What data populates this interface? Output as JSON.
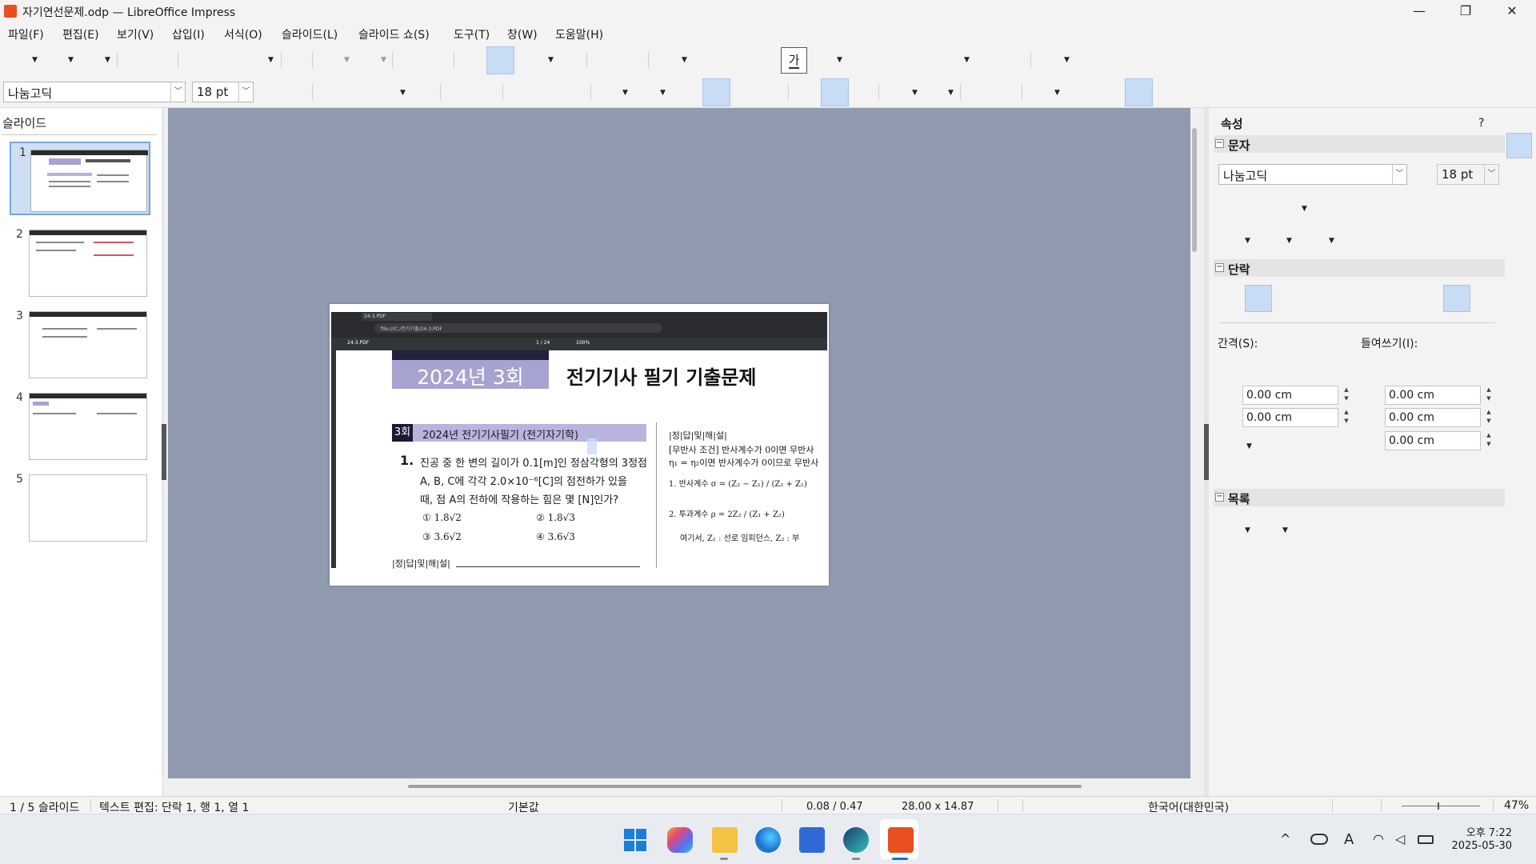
{
  "window": {
    "title": "자기연선문제.odp — LibreOffice Impress",
    "minimize": "—",
    "maximize": "❐",
    "close": "✕"
  },
  "menu": [
    "파일(F)",
    "편집(E)",
    "보기(V)",
    "삽입(I)",
    "서식(O)",
    "슬라이드(L)",
    "슬라이드 쇼(S)",
    "도구(T)",
    "창(W)",
    "도움말(H)"
  ],
  "toolbar": {
    "textbox_icon": "가",
    "font_name": "나눔고딕",
    "font_size": "18 pt"
  },
  "slides_panel": {
    "header": "슬라이드",
    "numbers": [
      "1",
      "2",
      "3",
      "4",
      "5"
    ]
  },
  "slide": {
    "browser_url": "file:///C:/전기기출/24-3.PDF",
    "tab_label": "24-3.PDF",
    "pdf_name": "24-3.PDF",
    "page": "1 / 24",
    "zoom": "100%",
    "year_label": "2024년  3회",
    "exam_title": "전기기사 필기 기출문제",
    "section_badge": "3회",
    "section_title": "2024년 전기기사필기 (전기자기학)",
    "q_num": "1.",
    "q_line1": "진공 중 한 변의 길이가 0.1[m]인 정삼각형의 3정점",
    "q_line2": "A, B, C에 각각 2.0×10⁻⁶[C]의 점전하가 있을",
    "q_line3": "때, 점 A의 전하에 작용하는 힘은 몇 [N]인가?",
    "choices": [
      "① 1.8√2",
      "② 1.8√3",
      "③ 3.6√2",
      "④ 3.6√3"
    ],
    "answer_head_left": "|정|답|및|해|설|",
    "answer_head_right": "|정|답|및|해|설|",
    "ans1": "[무반사 조건] 반사계수가 0이면 무반사",
    "ans2": "η₁ = η₂이면 반사계수가 0이므로 무반사",
    "ans3": "1. 반사계수 σ = (Z₂ − Z₁) / (Z₂ + Z₁)",
    "ans4": "2. 투과계수 ρ = 2Z₂ / (Z₁ + Z₂)",
    "ans5": "여기서, Z₁ : 선로 임피던스, Z₂ : 부"
  },
  "sidebar": {
    "title": "속성",
    "help": "?",
    "section_char": "문자",
    "font_name": "나눔고딕",
    "font_size": "18 pt",
    "section_para": "단락",
    "spacing_label": "간격(S):",
    "indent_label": "들여쓰기(I):",
    "spacing_values": [
      "0.00 cm",
      "0.00 cm"
    ],
    "indent_values": [
      "0.00 cm",
      "0.00 cm",
      "0.00 cm"
    ],
    "section_list": "목록"
  },
  "status": {
    "slide": "1 / 5 슬라이드",
    "mode": "텍스트 편집: 단락 1, 행 1, 열 1",
    "layout": "기본값",
    "position": "0.08 / 0.47",
    "size": "28.00 x 14.87",
    "language": "한국어(대한민국)",
    "zoom": "47%"
  },
  "tray": {
    "chevron": "^",
    "ime": "A",
    "time": "오후 7:22",
    "date": "2025-05-30"
  },
  "colors": {
    "accent": "#c9dcf5",
    "workspace": "#919bb0",
    "impress_orange": "#e8501f"
  }
}
